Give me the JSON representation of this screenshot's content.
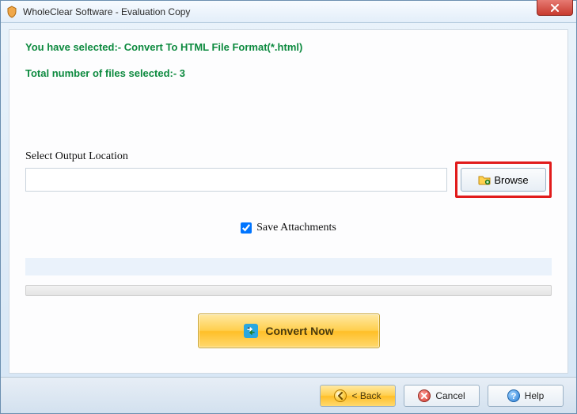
{
  "window": {
    "title": "WholeClear Software - Evaluation Copy"
  },
  "messages": {
    "selected_format": "You have selected:- Convert To HTML File Format(*.html)",
    "total_files": "Total number of files selected:- 3"
  },
  "output": {
    "label": "Select Output Location",
    "path": "",
    "browse_label": "Browse"
  },
  "save_attachments": {
    "label": "Save Attachments",
    "checked": true
  },
  "convert": {
    "label": "Convert Now"
  },
  "footer": {
    "back": "< Back",
    "cancel": "Cancel",
    "help": "Help"
  }
}
